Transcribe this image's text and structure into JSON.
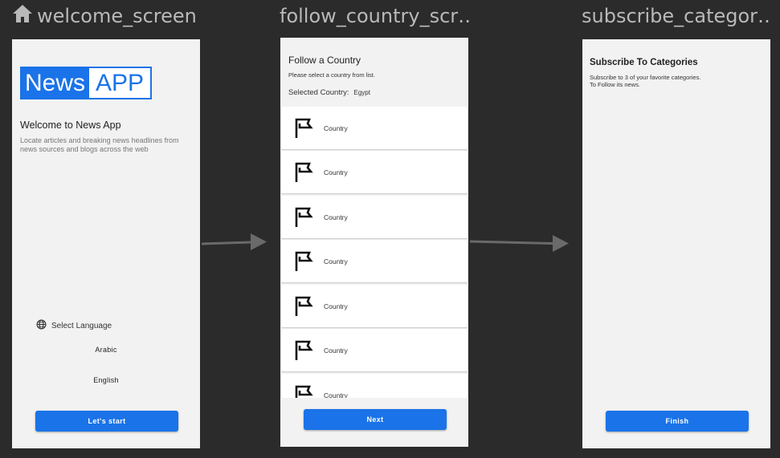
{
  "screens": {
    "welcome": {
      "title": "welcome_screen",
      "logo_part1": "News",
      "logo_part2": "APP",
      "heading": "Welcome to News App",
      "description": "Locate articles and breaking news headlines from news sources and blogs across the web",
      "select_language": "Select Language",
      "lang_options": [
        "Arabic",
        "English"
      ],
      "start_button": "Let's start"
    },
    "follow_country": {
      "title": "follow_country_scr…",
      "heading": "Follow a Country",
      "subtitle": "Please select a country from list.",
      "selected_label": "Selected Country:",
      "selected_value": "Egypt",
      "items": [
        "Country",
        "Country",
        "Country",
        "Country",
        "Country",
        "Country",
        "Country"
      ],
      "next_button": "Next"
    },
    "subscribe": {
      "title": "subscribe_categor…",
      "heading": "Subscribe To Categories",
      "desc_line1": "Subscribe to 3 of your favorite categories.",
      "desc_line2": "To Follow its news.",
      "finish_button": "Finish"
    }
  },
  "colors": {
    "background": "#2b2b2c",
    "accent": "#1a73e8",
    "arrow": "#6a6a6a"
  }
}
